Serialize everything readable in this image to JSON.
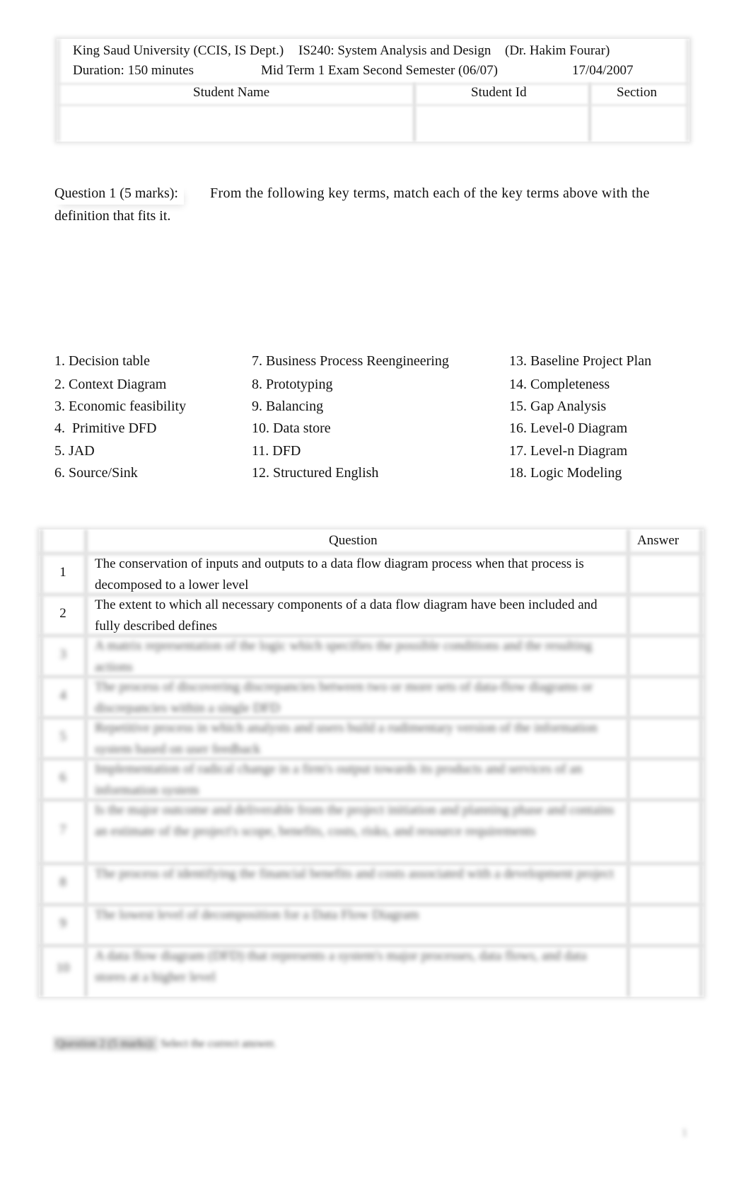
{
  "header": {
    "university": "King Saud University (CCIS, IS Dept.)",
    "course": "IS240: System Analysis and Design",
    "instructor": "(Dr. Hakim Fourar)",
    "duration": "Duration: 150 minutes",
    "exam": "Mid Term 1 Exam Second Semester (06/07)",
    "date": "17/04/2007",
    "columns": [
      "Student Name",
      "Student Id",
      "Section"
    ],
    "values": [
      "",
      "",
      ""
    ]
  },
  "question1": {
    "label": "Question 1 (5 marks):",
    "text_line1": "From the following key terms, match each of the key terms above with the",
    "text_line2": "definition that fits it."
  },
  "key_terms": [
    [
      "1. Decision table",
      "2. Context Diagram",
      "3. Economic feasibility",
      "4.  Primitive DFD",
      "5. JAD",
      "6. Source/Sink"
    ],
    [
      "7. Business Process Reengineering",
      "8. Prototyping",
      "9. Balancing",
      "10. Data store",
      "11. DFD",
      "12. Structured English"
    ],
    [
      "13. Baseline Project Plan",
      "14. Completeness",
      "15. Gap Analysis",
      "16. Level-0 Diagram",
      "17. Level-n Diagram",
      "18. Logic Modeling"
    ]
  ],
  "answer_table": {
    "headers": {
      "number": "",
      "question": "Question",
      "answer": "Answer"
    },
    "rows": [
      {
        "n": "1",
        "q": "The conservation of inputs and outputs to a data flow diagram process when that process is decomposed to a lower level",
        "a": "",
        "blurred": false
      },
      {
        "n": "2",
        "q": "The extent to which all necessary components of a data flow diagram have been included and fully described defines",
        "a": "",
        "blurred": false
      },
      {
        "n": "3",
        "q": "A matrix representation of the logic which specifies the possible conditions and the resulting actions",
        "a": "",
        "blurred": true
      },
      {
        "n": "4",
        "q": "The process of discovering discrepancies between two or more sets of data-flow diagrams or discrepancies within a single DFD",
        "a": "",
        "blurred": true
      },
      {
        "n": "5",
        "q": "Repetitive process in which analysts and users build a rudimentary version of the information system based on user feedback",
        "a": "",
        "blurred": true
      },
      {
        "n": "6",
        "q": "Implementation of radical change in a firm's output towards its products and services of an information system",
        "a": "",
        "blurred": true
      },
      {
        "n": "7",
        "q": "Is the major outcome and deliverable from the project initiation and planning phase and contains an estimate of the project's scope, benefits, costs, risks, and resource requirements",
        "a": "",
        "blurred": true
      },
      {
        "n": "8",
        "q": "The process of identifying the financial benefits and costs associated with a development project",
        "a": "",
        "blurred": true
      },
      {
        "n": "9",
        "q": "The lowest level of decomposition for a Data Flow Diagram",
        "a": "",
        "blurred": true
      },
      {
        "n": "10",
        "q": "A data flow diagram (DFD) that represents a system's major processes, data flows, and data stores at a higher level",
        "a": "",
        "blurred": true
      }
    ]
  },
  "question2": {
    "label": "Question 2 (5 marks):",
    "text": "Select the correct answer."
  },
  "page_number": "1"
}
